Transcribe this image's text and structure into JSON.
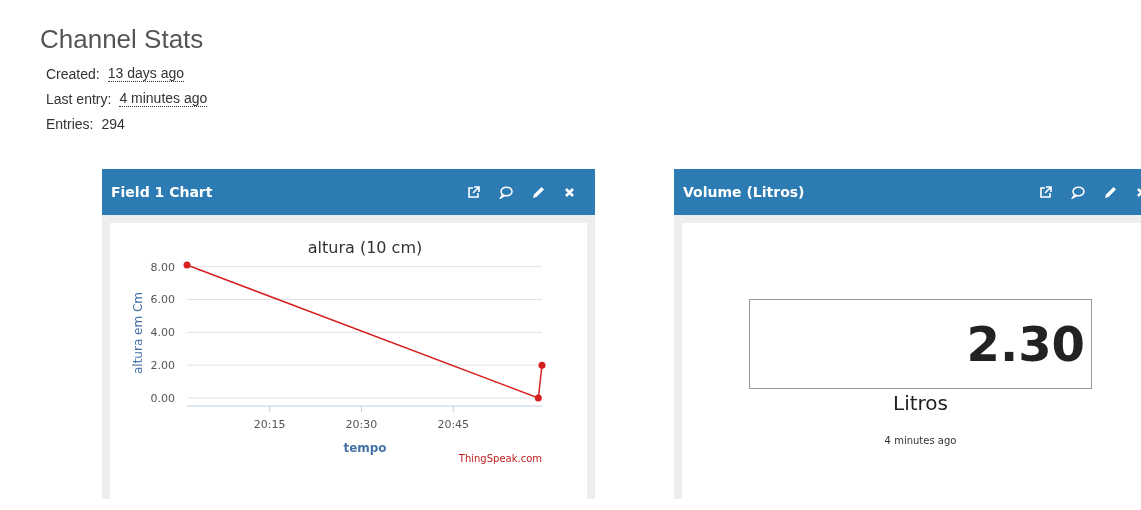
{
  "title": "Channel Stats",
  "stats": [
    {
      "label": "Created:",
      "value": "13 days ago",
      "kind": "time"
    },
    {
      "label": "Last entry:",
      "value": "4 minutes ago",
      "kind": "time"
    },
    {
      "label": "Entries:",
      "value": "294",
      "kind": "count"
    }
  ],
  "panels": [
    {
      "title": "Field 1 Chart",
      "kind": "chart",
      "credit": "ThingSpeak.com",
      "chart_data": {
        "type": "line",
        "title": "altura (10 cm)",
        "xlabel": "tempo",
        "ylabel": "altura em Cm",
        "x": [
          1201.5,
          1258.9,
          1259.5
        ],
        "grid": true,
        "series": [
          {
            "color": "#d62020",
            "marker": "circle",
            "values": [
              8.1,
              0,
              2
            ]
          }
        ],
        "xlim": [
          1201.5,
          1259.5
        ],
        "ylim": [
          0,
          8.1
        ],
        "xticks": [
          {
            "value": 1215,
            "label": "20:15"
          },
          {
            "value": 1230,
            "label": "20:30"
          },
          {
            "value": 1245,
            "label": "20:45"
          }
        ],
        "yticks": [
          {
            "value": 0,
            "label": "0.00"
          },
          {
            "value": 2,
            "label": "2.00"
          },
          {
            "value": 4,
            "label": "4.00"
          },
          {
            "value": 6,
            "label": "6.00"
          },
          {
            "value": 8,
            "label": "8.00"
          }
        ]
      }
    },
    {
      "title": "Volume (Litros)",
      "kind": "numeric",
      "value": "2.30",
      "units": "Litros",
      "updated": "4 minutes ago"
    }
  ]
}
